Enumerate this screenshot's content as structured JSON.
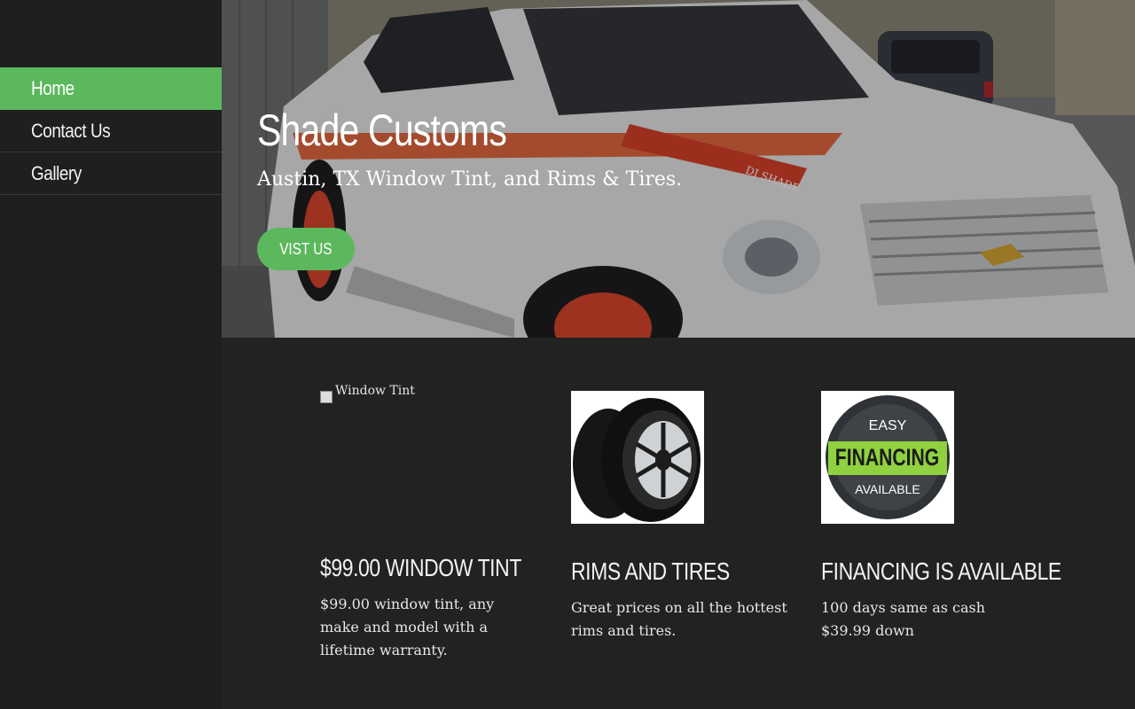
{
  "nav": {
    "items": [
      {
        "label": "Home",
        "active": true
      },
      {
        "label": "Contact Us",
        "active": false
      },
      {
        "label": "Gallery",
        "active": false
      }
    ]
  },
  "hero": {
    "title": "Shade Customs",
    "subtitle": "Austin, TX Window Tint, and Rims & Tires.",
    "button_label": "VIST US",
    "image_text": "DJ SHADE"
  },
  "features": [
    {
      "title": "$99.00 WINDOW TINT",
      "image_alt": "Window Tint",
      "lines": [
        "$99.00 window tint, any make and model with a lifetime warranty."
      ]
    },
    {
      "title": "RIMS AND TIRES",
      "lines": [
        "Great prices on all the hottest rims and tires."
      ]
    },
    {
      "title": "FINANCING IS AVAILABLE",
      "badge_line1": "EASY",
      "badge_line2": "FINANCING",
      "badge_line3": "AVAILABLE",
      "lines": [
        "100 days same as cash",
        "$39.99 down"
      ]
    }
  ],
  "colors": {
    "accent": "#5cb85c",
    "sidebar": "#1f1f1f",
    "background": "#222222"
  }
}
